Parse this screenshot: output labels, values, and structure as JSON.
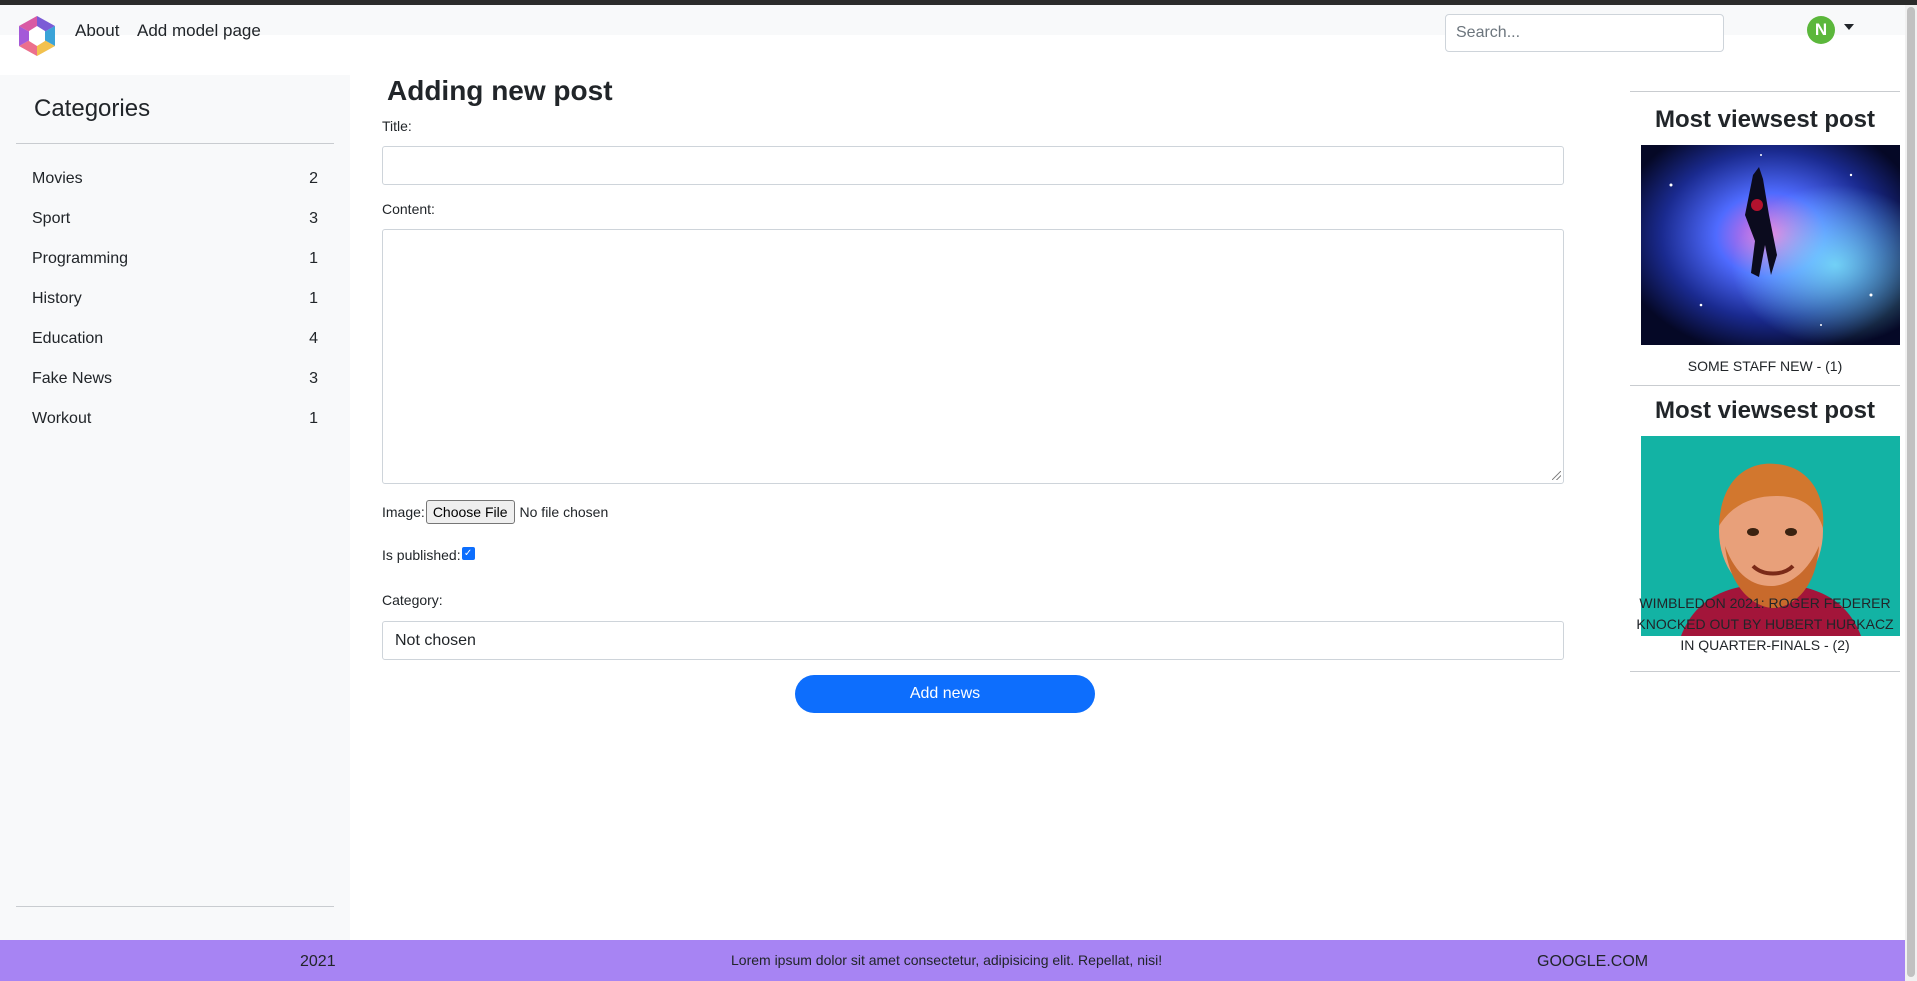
{
  "nav": {
    "about": "About",
    "add_model": "Add model page",
    "search_placeholder": "Search...",
    "avatar_initial": "N"
  },
  "sidebar": {
    "title": "Categories",
    "items": [
      {
        "label": "Movies",
        "count": "2"
      },
      {
        "label": "Sport",
        "count": "3"
      },
      {
        "label": "Programming",
        "count": "1"
      },
      {
        "label": "History",
        "count": "1"
      },
      {
        "label": "Education",
        "count": "4"
      },
      {
        "label": "Fake News",
        "count": "3"
      },
      {
        "label": "Workout",
        "count": "1"
      }
    ]
  },
  "form": {
    "heading": "Adding new post",
    "title_label": "Title:",
    "content_label": "Content:",
    "image_label": "Image:",
    "file_button": "Choose File",
    "file_status": "No file chosen",
    "published_label": "Is published:",
    "published_checked": true,
    "category_label": "Category:",
    "category_value": "Not chosen",
    "submit_label": "Add news"
  },
  "popular": {
    "cards": [
      {
        "title": "Most viewsest post",
        "caption": "SOME STAFF NEW - (1)",
        "image": "astronaut-space-illustration"
      },
      {
        "title": "Most viewsest post",
        "caption": "WIMBLEDON 2021: ROGER FEDERER KNOCKED OUT BY HUBERT HURKACZ IN QUARTER-FINALS - (2)",
        "image": "cartoon-bearded-man-portrait"
      }
    ]
  },
  "footer": {
    "year": "2021",
    "text": "Lorem ipsum dolor sit amet consectetur, adipisicing elit. Repellat, nisi!",
    "link": "GOOGLE.COM"
  },
  "colors": {
    "primary": "#0d6efd",
    "footer_bg": "#a784f3",
    "sidebar_bg": "#f8f9fa",
    "avatar_bg": "#5bb73b"
  }
}
